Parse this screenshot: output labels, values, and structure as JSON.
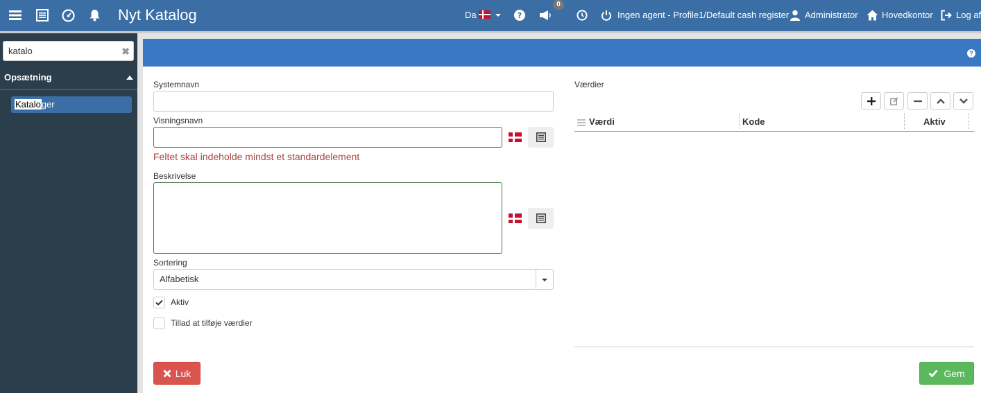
{
  "header": {
    "title": "Nyt Katalog",
    "language": "Da",
    "notification_count": "0",
    "agent_status": "Ingen agent - Profile1/Default cash register",
    "user": "Administrator",
    "office": "Hovedkontor",
    "logout": "Log af"
  },
  "sidebar": {
    "search_value": "katalo",
    "section": "Opsætning",
    "item_highlight": "Katalo",
    "item_rest": "ger"
  },
  "form": {
    "systemnavn_label": "Systemnavn",
    "systemnavn_value": "",
    "visningsnavn_label": "Visningsnavn",
    "visningsnavn_value": "",
    "visningsnavn_error": "Feltet skal indeholde mindst et standardelement",
    "beskrivelse_label": "Beskrivelse",
    "beskrivelse_value": "",
    "sortering_label": "Sortering",
    "sortering_value": "Alfabetisk",
    "aktiv_label": "Aktiv",
    "aktiv_checked": true,
    "tillad_label": "Tillad at tilføje værdier",
    "tillad_checked": false
  },
  "values_panel": {
    "title": "Værdier",
    "columns": [
      "Værdi",
      "Kode",
      "Aktiv"
    ],
    "rows": []
  },
  "buttons": {
    "close": "Luk",
    "save": "Gem"
  },
  "colors": {
    "topbar": "#3a6ea5",
    "panel_header": "#3a78c4",
    "sidebar": "#2c3e4c",
    "error": "#a94442",
    "danger": "#d9534f",
    "success": "#5cb85c"
  }
}
